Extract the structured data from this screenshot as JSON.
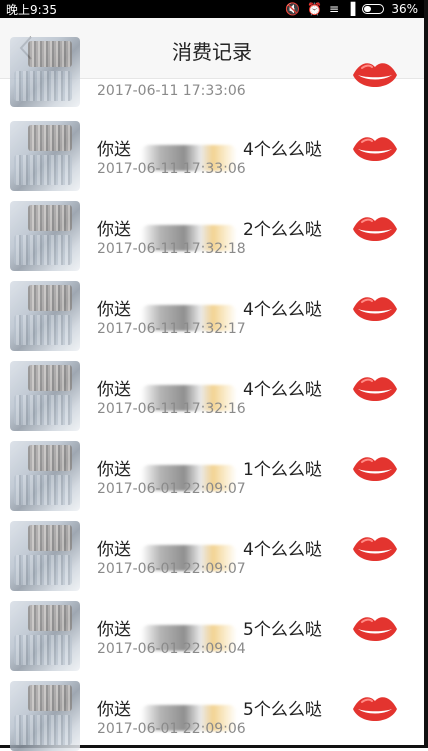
{
  "status_bar": {
    "time": "晚上9:35",
    "battery": "36%"
  },
  "header": {
    "title": "消费记录"
  },
  "records": [
    {
      "prefix": "",
      "amount": "",
      "time": "2017-06-11 17:33:06"
    },
    {
      "prefix": "你送",
      "amount": "4个么么哒",
      "time": "2017-06-11 17:33:06"
    },
    {
      "prefix": "你送",
      "amount": "2个么么哒",
      "time": "2017-06-11 17:32:18"
    },
    {
      "prefix": "你送",
      "amount": "4个么么哒",
      "time": "2017-06-11 17:32:17"
    },
    {
      "prefix": "你送",
      "amount": "4个么么哒",
      "time": "2017-06-11 17:32:16"
    },
    {
      "prefix": "你送",
      "amount": "1个么么哒",
      "time": "2017-06-01 22:09:07"
    },
    {
      "prefix": "你送",
      "amount": "4个么么哒",
      "time": "2017-06-01 22:09:07"
    },
    {
      "prefix": "你送",
      "amount": "5个么么哒",
      "time": "2017-06-01 22:09:04"
    },
    {
      "prefix": "你送",
      "amount": "5个么么哒",
      "time": "2017-06-01 22:09:06"
    }
  ],
  "icons": {
    "back": "chevron-left-icon",
    "gift": "lips-icon"
  },
  "colors": {
    "lips": "#e3342f",
    "timestamp": "#8a8a8a"
  }
}
